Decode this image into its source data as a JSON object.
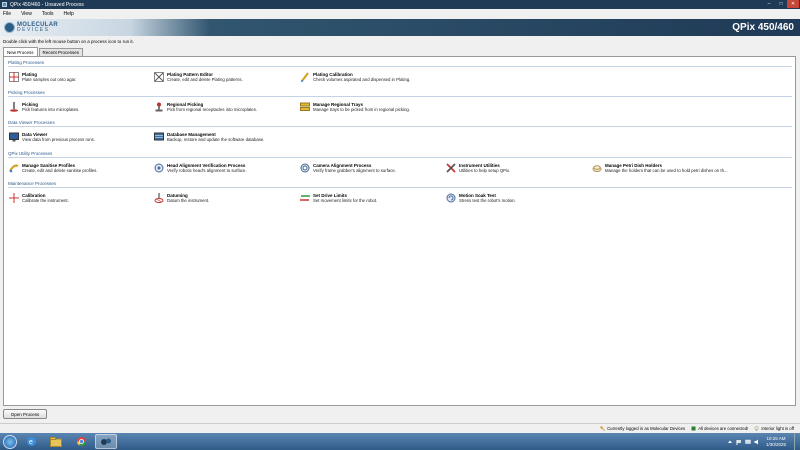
{
  "window": {
    "title": "QPix 450/460 - Unsaved Process",
    "minimize": "–",
    "maximize": "□",
    "close": "✕"
  },
  "menu": [
    "File",
    "View",
    "Tools",
    "Help"
  ],
  "banner": {
    "logo_line1": "MOLECULAR",
    "logo_line2": "DEVICES",
    "product": "QPix 450/460"
  },
  "instruction": "Double click with the left mouse button on a process icon to run it.",
  "tabs": [
    "New Process",
    "Recent Processes"
  ],
  "sections": [
    {
      "title": "Plating Processes",
      "items": [
        {
          "name": "Plating",
          "desc": "Plate samples out onto agar.",
          "icon": "plating-icon"
        },
        {
          "name": "Plating Pattern Editor",
          "desc": "Create, edit and delete Plating patterns.",
          "icon": "pattern-editor-icon"
        },
        {
          "name": "Plating Calibration",
          "desc": "Check volumes aspirated and dispensed in Plating.",
          "icon": "calibration-pipette-icon"
        }
      ]
    },
    {
      "title": "Picking Processes",
      "items": [
        {
          "name": "Picking",
          "desc": "Pick features into microplates.",
          "icon": "picking-icon"
        },
        {
          "name": "Regional Picking",
          "desc": "Pick from regional receptacles into microplates.",
          "icon": "joystick-icon"
        },
        {
          "name": "Manage Regional Trays",
          "desc": "Manage trays to be picked from in regional picking.",
          "icon": "trays-icon"
        }
      ]
    },
    {
      "title": "Data Viewer Processes",
      "items": [
        {
          "name": "Data Viewer",
          "desc": "View data from previous process runs.",
          "icon": "data-viewer-icon"
        },
        {
          "name": "Database Management",
          "desc": "Backup, restore and update the software database.",
          "icon": "database-icon"
        }
      ]
    },
    {
      "title": "QPix Utility Processes",
      "items": [
        {
          "name": "Manage Sanitise Profiles",
          "desc": "Create, edit and delete sanitise profiles.",
          "icon": "sanitise-icon"
        },
        {
          "name": "Head Alignment Verification Process",
          "desc": "Verify robotic head's alignment to surface.",
          "icon": "head-alignment-icon"
        },
        {
          "name": "Camera Alignment Process",
          "desc": "Verify frame grabber's alignment to surface.",
          "icon": "camera-alignment-icon"
        },
        {
          "name": "Instrument Utilities",
          "desc": "Utilities to help setup QPix.",
          "icon": "tools-icon"
        },
        {
          "name": "Manage Petri Dish Holders",
          "desc": "Manage the holders that can be used to hold petri dishes on th...",
          "icon": "petri-holder-icon"
        }
      ]
    },
    {
      "title": "Maintenance Processes",
      "items": [
        {
          "name": "Calibration",
          "desc": "Calibrate the instrument.",
          "icon": "crosshair-icon"
        },
        {
          "name": "Datuming",
          "desc": "Datum the instrument.",
          "icon": "datum-icon"
        },
        {
          "name": "Set Drive Limits",
          "desc": "Set movement limits for the robot.",
          "icon": "drive-limits-icon"
        },
        {
          "name": "Motion Soak Test",
          "desc": "Stress test the robot's motion.",
          "icon": "motion-soak-icon"
        }
      ]
    }
  ],
  "open_button": "Open Process",
  "status": [
    {
      "text": "Currently logged in as Molecular Devices",
      "icon": "key-icon",
      "color": "#c89b2a"
    },
    {
      "text": "All devices are connected!",
      "icon": "device-icon",
      "color": "#2e7d32"
    },
    {
      "text": "Interior light is off",
      "icon": "bulb-icon",
      "color": "#b8b8b8"
    }
  ],
  "taskbar": {
    "time": "10:25 AM",
    "date": "1/30/2025"
  },
  "colors": {
    "titlebar": "#1f3a56",
    "section_title": "#2e5a8c",
    "taskbar": "#2f5a87"
  }
}
